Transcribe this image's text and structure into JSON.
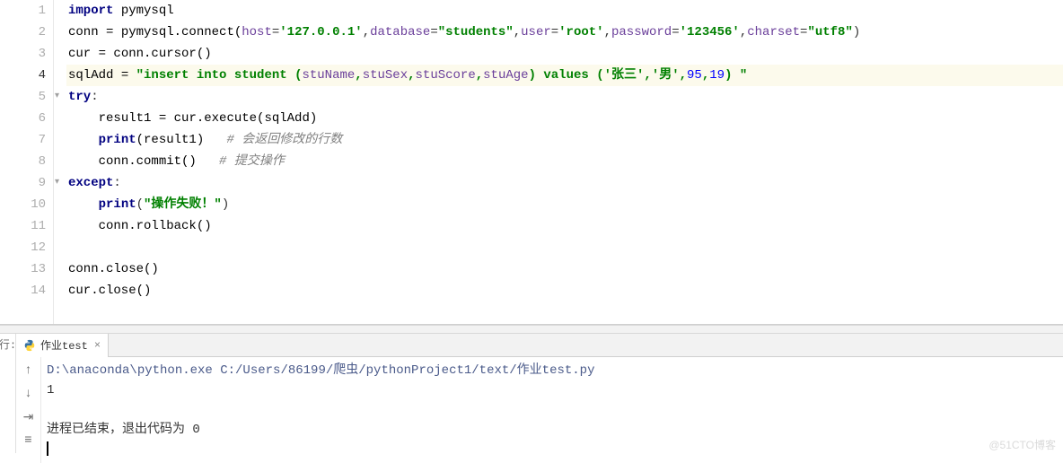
{
  "gutter": [
    "1",
    "2",
    "3",
    "4",
    "5",
    "6",
    "7",
    "8",
    "9",
    "10",
    "11",
    "12",
    "13",
    "14"
  ],
  "active_line": 4,
  "code": {
    "l1": {
      "kw": "import",
      "mod": "pymysql"
    },
    "l2": {
      "a": "conn ",
      "op": "=",
      "b": " pymysql.connect(",
      "p1k": "host",
      "p1v": "'127.0.0.1'",
      "c1": ",",
      "p2k": "database",
      "p2v": "\"students\"",
      "c2": ",",
      "p3k": "user",
      "p3v": "'root'",
      "c3": ",",
      "p4k": "password",
      "p4v": "'123456'",
      "c4": ",",
      "p5k": "charset",
      "p5v": "\"utf8\"",
      "close": ")"
    },
    "l3": {
      "a": "cur ",
      "op": "=",
      "b": " conn.cursor()"
    },
    "l4": {
      "a": "sqlAdd ",
      "op": "=",
      "sp": " ",
      "s1": "\"insert into ",
      "tbl": "student ",
      "paren": "(",
      "f1": "stuName",
      "c1": ",",
      "f2": "stuSex",
      "c2": ",",
      "f3": "stuScore",
      "c3": ",",
      "f4": "stuAge",
      "paren2": ") ",
      "kw2": "values ",
      "paren3": "(",
      "v1": "'张三'",
      "c4": ",",
      "v2": "'男'",
      "c5": ",",
      "v3": "95",
      "c6": ",",
      "v4": "19",
      "paren4": ") \""
    },
    "l5": {
      "kw": "try",
      "colon": ":"
    },
    "l6": {
      "ind": "    ",
      "a": "result1 ",
      "op": "=",
      "b": " cur.execute(sqlAdd)"
    },
    "l7": {
      "ind": "    ",
      "fn": "print",
      "args": "(result1)",
      "sp": "   ",
      "cmt": "# 会返回修改的行数"
    },
    "l8": {
      "ind": "    ",
      "call": "conn.commit()",
      "sp": "   ",
      "cmt": "# 提交操作"
    },
    "l9": {
      "kw": "except",
      "colon": ":"
    },
    "l10": {
      "ind": "    ",
      "fn": "print",
      "open": "(",
      "str": "\"操作失败！\"",
      "close": ")"
    },
    "l11": {
      "ind": "    ",
      "call": "conn.rollback()"
    },
    "l13": {
      "call": "conn.close()"
    },
    "l14": {
      "call": "cur.close()"
    }
  },
  "run": {
    "label": "行:",
    "tab_name": "作业test",
    "cmd": "D:\\anaconda\\python.exe C:/Users/86199/爬虫/pythonProject1/text/作业test.py",
    "out1": "1",
    "exit": "进程已结束，退出代码为 0"
  },
  "watermark": "@51CTO博客"
}
